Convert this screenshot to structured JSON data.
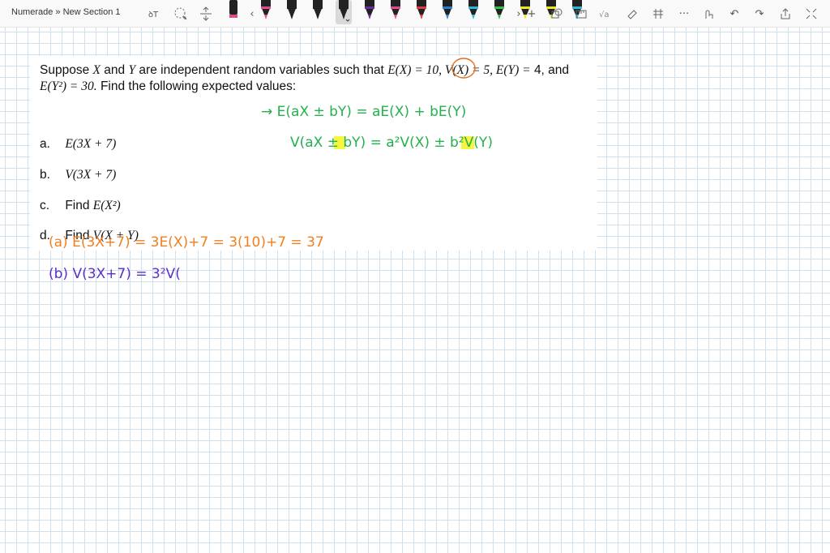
{
  "breadcrumb": {
    "notebook": "Numerade",
    "separator": "»",
    "section": "New Section 1"
  },
  "toolbar": {
    "pen_colors": [
      "#222222",
      "#e24a8b",
      "#222222",
      "#222222",
      "#222222",
      "#6a2aa0",
      "#e24a8b",
      "#e03a3a",
      "#2a7fd4",
      "#2ab8d8",
      "#2fc24a",
      "#e8e82a",
      "#e8e82a",
      "#2ab8d8"
    ],
    "selected_pen_index": 4
  },
  "problem": {
    "intro_line1_a": "Suppose",
    "var_x": "X",
    "and": "and",
    "var_y": "Y",
    "intro_line1_b": "are independent random variables such that",
    "ex": "E(X) = 10, V(X) = 5, E(Y) =",
    "intro_line2_a": "4, and",
    "ey2": "E(Y²) = 30.",
    "intro_line2_b": "Find the following expected values:",
    "parts": [
      {
        "label": "a.",
        "prefix": "",
        "math": "E(3X + 7)"
      },
      {
        "label": "b.",
        "prefix": "",
        "math": "V(3X + 7)"
      },
      {
        "label": "c.",
        "prefix": "Find",
        "math": "E(X²)"
      },
      {
        "label": "d.",
        "prefix": "Find",
        "math": "V(X + Y)"
      }
    ]
  },
  "handwriting": {
    "green_line1": "→ E(aX ± bY) = aE(X) + bE(Y)",
    "green_line2": "V(aX ± bY) = a²V(X) ± b²V(Y)",
    "orange_line": "(a)  E(3X+7) = 3E(X)+7 = 3(10)+7 = 37",
    "purple_line": "(b)  V(3X+7) = 3²V(",
    "colors": {
      "green": "#22b14c",
      "orange": "#f08020",
      "purple": "#5b2fc9",
      "highlight": "#f5f520",
      "circle": "#e07020"
    }
  }
}
